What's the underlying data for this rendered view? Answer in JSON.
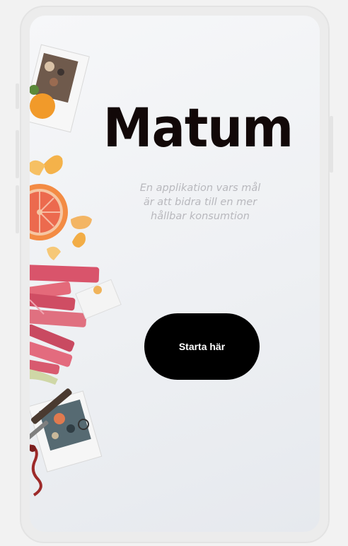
{
  "app": {
    "title": "Matum",
    "tagline": "En applikation vars mål är att bidra till en mer hållbar konsumtion"
  },
  "actions": {
    "start_label": "Starta här"
  },
  "colors": {
    "title": "#120808",
    "tagline": "#b8b8bd",
    "button_bg": "#000000",
    "button_text": "#ffffff",
    "background": "#eef0f3"
  },
  "decor": {
    "image_subject": "food-flatlay-photo"
  }
}
